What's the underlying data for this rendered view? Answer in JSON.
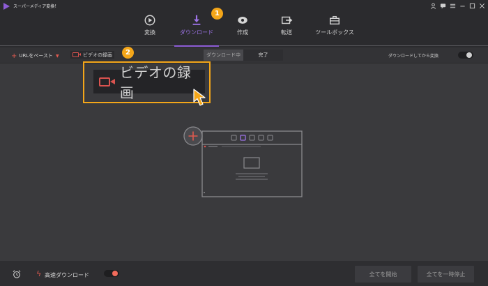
{
  "window": {
    "title": "スーパーメディア変換！",
    "controls": [
      "user-icon",
      "chat-icon",
      "menu-icon",
      "minimize-icon",
      "maximize-icon",
      "close-icon"
    ]
  },
  "nav": {
    "items": [
      {
        "label": "変換",
        "icon": "convert-icon",
        "active": false
      },
      {
        "label": "ダウンロード",
        "icon": "download-icon",
        "active": true
      },
      {
        "label": "作成",
        "icon": "burn-icon",
        "active": false
      },
      {
        "label": "転送",
        "icon": "transfer-icon",
        "active": false
      },
      {
        "label": "ツールボックス",
        "icon": "toolbox-icon",
        "active": false
      }
    ]
  },
  "badges": {
    "step1": "1",
    "step2": "2"
  },
  "toolbar": {
    "url_paste_label": "URLをペースト",
    "record_label": "ビデオの録画",
    "tab_downloading": "ダウンロード中",
    "tab_finished": "完了",
    "convert_after_label": "ダウンロードしてから変換",
    "convert_after_enabled": false
  },
  "zoom": {
    "label": "ビデオの録画"
  },
  "footer": {
    "fast_download_label": "高速ダウンロード",
    "fast_download_enabled": true,
    "start_all_label": "全てを開始",
    "pause_all_label": "全てを一時停止"
  },
  "colors": {
    "accent": "#8d5cd6",
    "badge": "#f4a619",
    "record_red": "#d9534f",
    "toggle_on": "#f26b5b"
  }
}
